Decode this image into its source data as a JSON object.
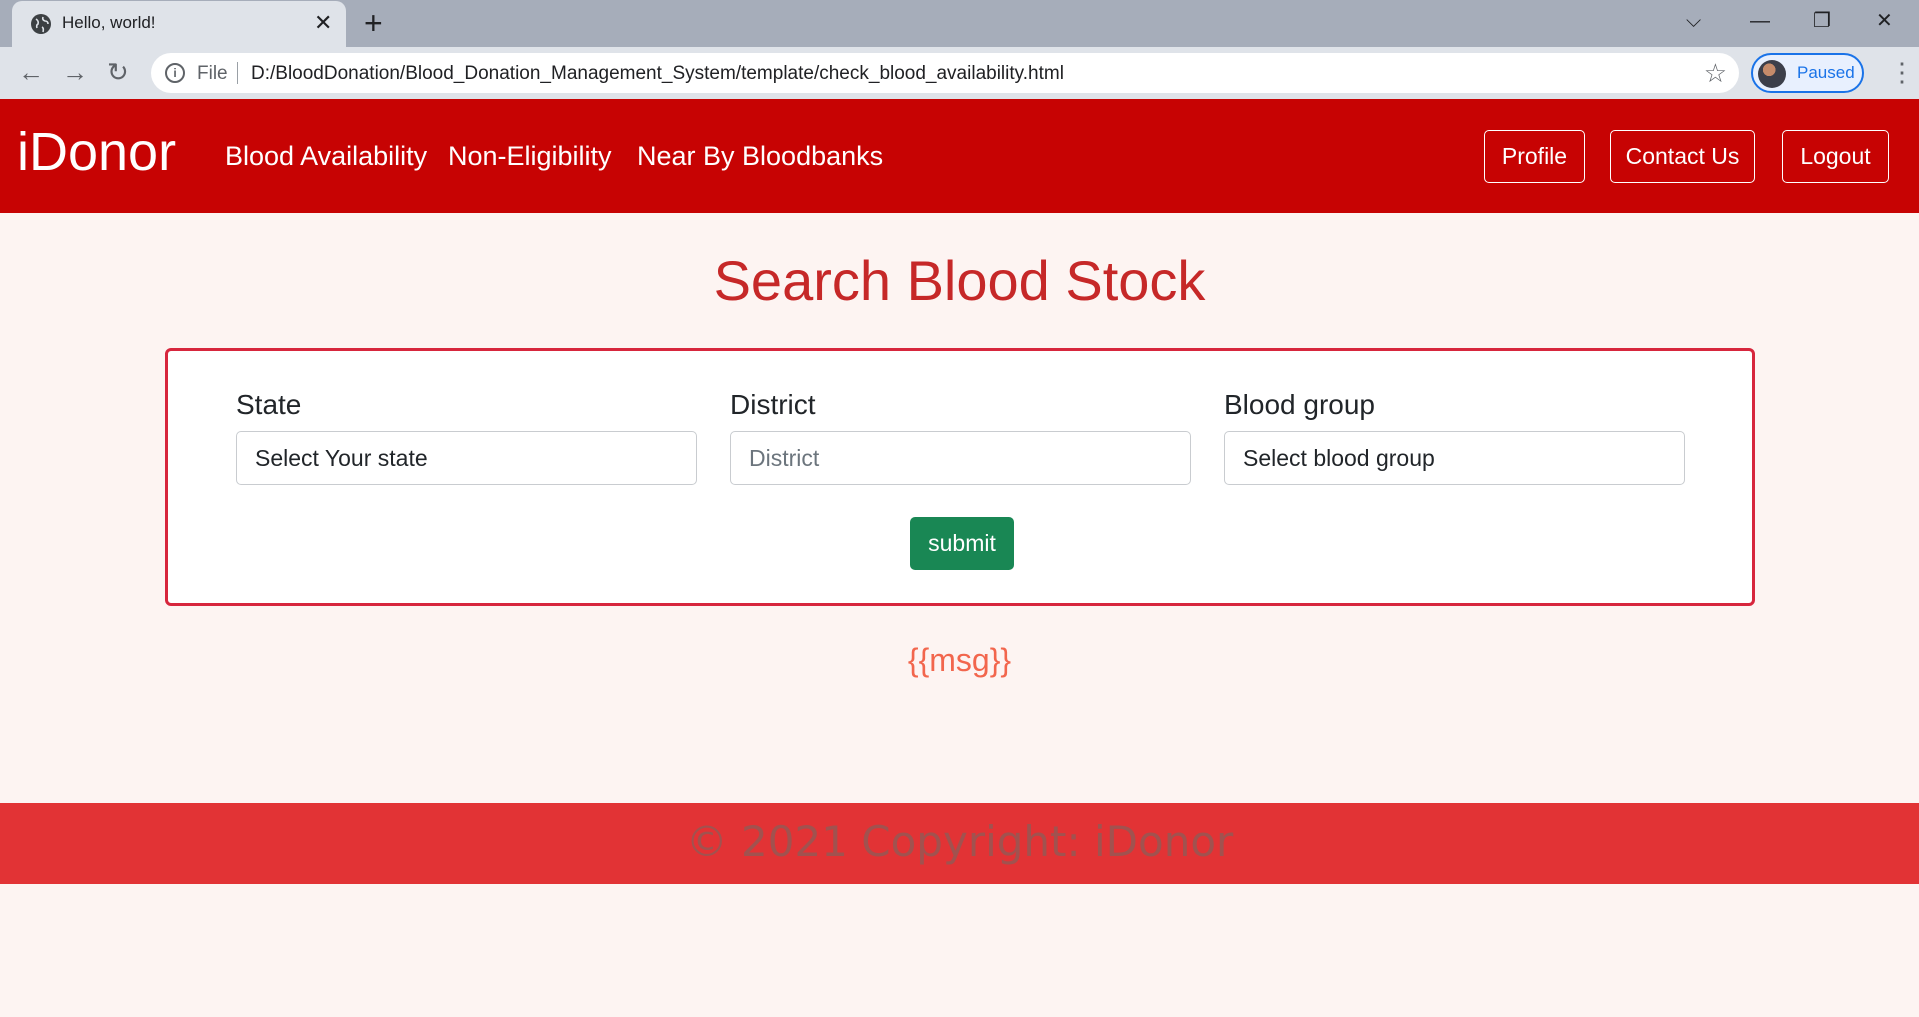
{
  "browser": {
    "tab_title": "Hello, world!",
    "tab_close": "✕",
    "new_tab": "+",
    "file_label": "File",
    "url": "D:/BloodDonation/Blood_Donation_Management_System/template/check_blood_availability.html",
    "profile_status": "Paused",
    "icons": [
      "globe-icon",
      "close-icon",
      "plus-icon",
      "back-icon",
      "forward-icon",
      "reload-icon",
      "info-icon",
      "star-icon",
      "menu-icon"
    ]
  },
  "navbar": {
    "brand": "iDonor",
    "links": [
      "Blood Availability",
      "Non-Eligibility",
      "Near By Bloodbanks"
    ],
    "buttons": [
      "Profile",
      "Contact Us",
      "Logout"
    ],
    "color": "#c70303"
  },
  "main": {
    "heading": "Search Blood Stock",
    "form": {
      "state_label": "State",
      "state_value": "Select Your state",
      "district_label": "District",
      "district_placeholder": "District",
      "blood_group_label": "Blood group",
      "blood_group_value": "Select blood group",
      "submit_label": "submit"
    },
    "msg": "{{msg}}"
  },
  "footer": {
    "copyright": "© 2021 Copyright: iDonor",
    "color": "#e23335"
  }
}
